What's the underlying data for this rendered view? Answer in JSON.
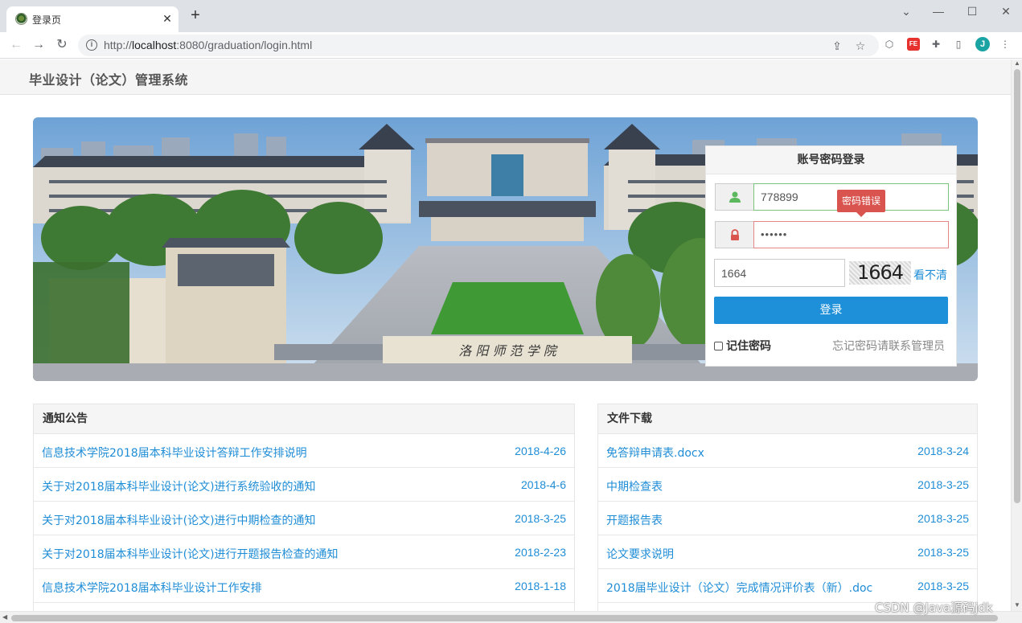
{
  "browser": {
    "tab_title": "登录页",
    "url_prefix": "http://",
    "url_host": "localhost",
    "url_rest": ":8080/graduation/login.html",
    "profile_initial": "J"
  },
  "site": {
    "title": "毕业设计（论文）管理系统"
  },
  "banner": {
    "gate_text": "洛 阳 师 范 学 院"
  },
  "login": {
    "heading": "账号密码登录",
    "username_value": "778899",
    "password_value": "••••••",
    "error_tooltip": "密码错误",
    "captcha_value": "1664",
    "captcha_image_text": "1664",
    "captcha_refresh": "看不清",
    "submit_label": "登录",
    "remember_label": "记住密码",
    "forgot_text": "忘记密码请联系管理员"
  },
  "notices": {
    "title": "通知公告",
    "items": [
      {
        "title": "信息技术学院2018届本科毕业设计答辩工作安排说明",
        "date": "2018-4-26"
      },
      {
        "title": "关于对2018届本科毕业设计(论文)进行系统验收的通知",
        "date": "2018-4-6"
      },
      {
        "title": "关于对2018届本科毕业设计(论文)进行中期检查的通知",
        "date": "2018-3-25"
      },
      {
        "title": "关于对2018届本科毕业设计(论文)进行开题报告检查的通知",
        "date": "2018-2-23"
      },
      {
        "title": "信息技术学院2018届本科毕业设计工作安排",
        "date": "2018-1-18"
      }
    ]
  },
  "downloads": {
    "title": "文件下载",
    "items": [
      {
        "title": "免答辩申请表.docx",
        "date": "2018-3-24"
      },
      {
        "title": "中期检查表",
        "date": "2018-3-25"
      },
      {
        "title": "开题报告表",
        "date": "2018-3-25"
      },
      {
        "title": "论文要求说明",
        "date": "2018-3-25"
      },
      {
        "title": "2018届毕业设计（论文）完成情况评价表（新）.doc",
        "date": "2018-3-25"
      }
    ]
  },
  "watermark": "CSDN @Java源码jdk"
}
